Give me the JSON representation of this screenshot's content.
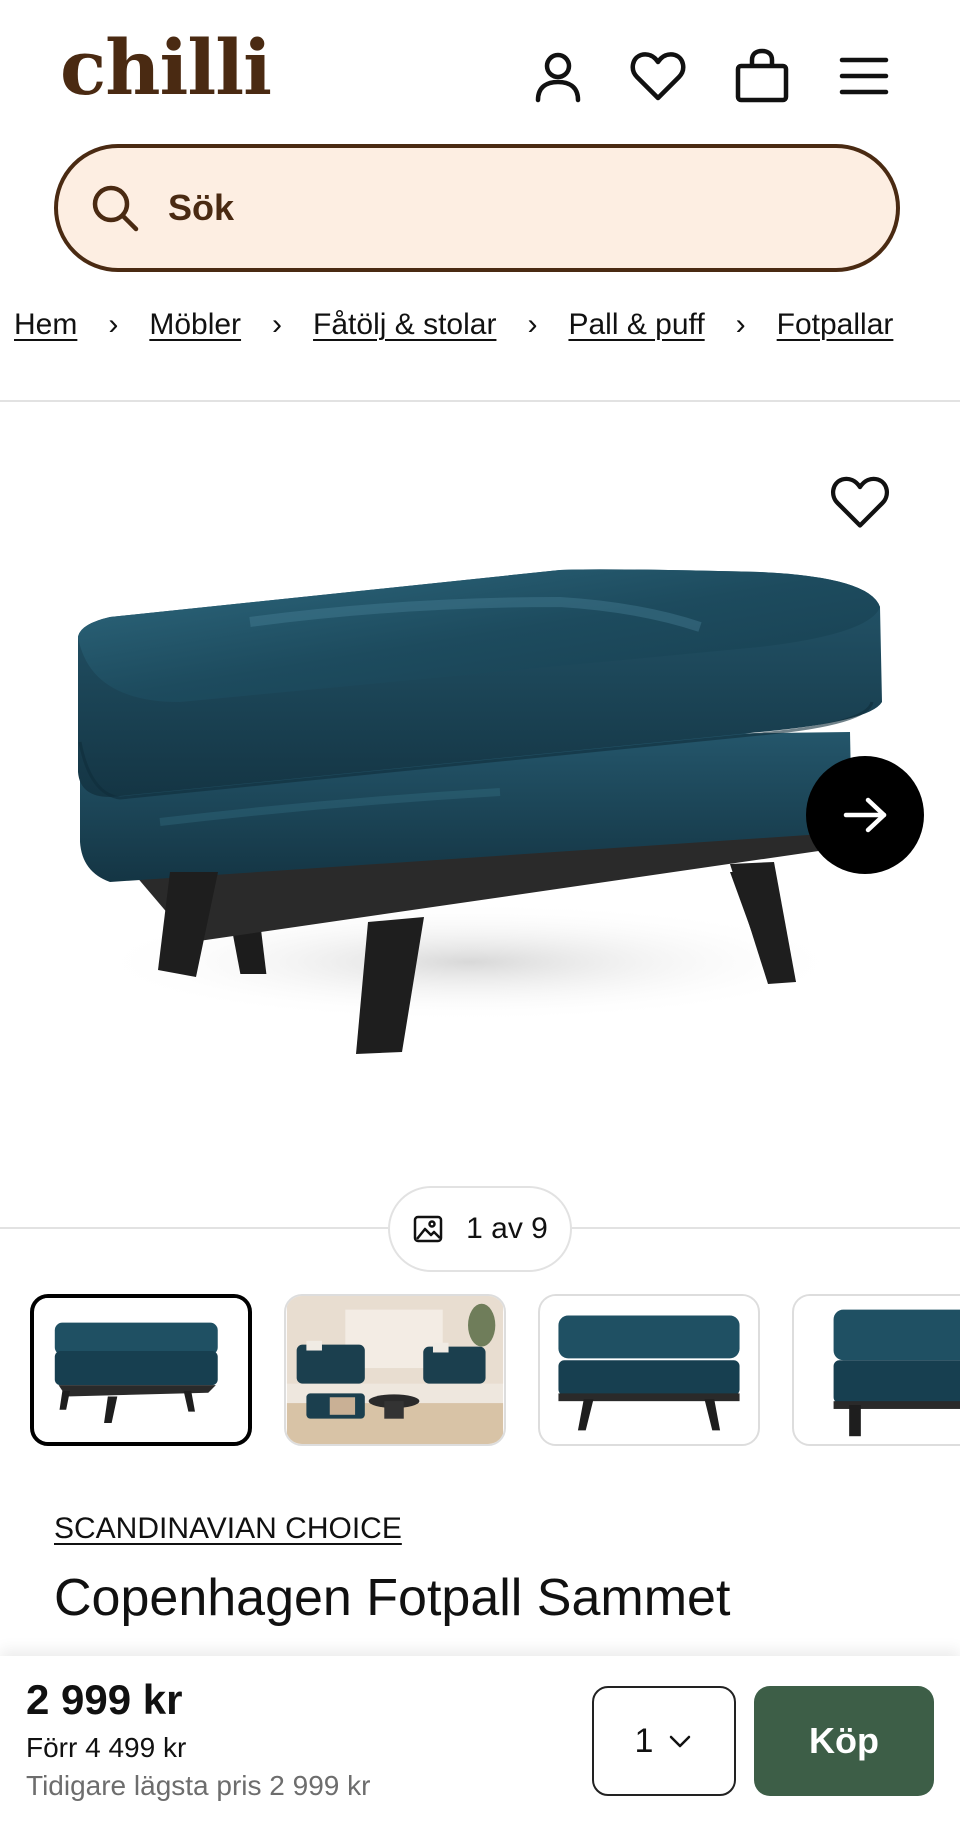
{
  "header": {
    "logo": "chilli",
    "icons": [
      "user-icon",
      "heart-icon",
      "shopping-bag-icon",
      "menu-icon"
    ]
  },
  "search": {
    "placeholder": "Sök"
  },
  "breadcrumb": {
    "items": [
      "Hem",
      "Möbler",
      "Fåtölj & stolar",
      "Pall & puff",
      "Fotpallar"
    ],
    "separator": "›"
  },
  "gallery": {
    "counter": "1 av 9",
    "thumbnail_count": 4
  },
  "product": {
    "brand": "SCANDINAVIAN CHOICE",
    "title": "Copenhagen Fotpall Sammet",
    "color": "#1d4b5e"
  },
  "buybar": {
    "price": "2 999 kr",
    "price_before": "Förr 4 499 kr",
    "price_lowest": "Tidigare lägsta pris 2 999 kr",
    "quantity": "1",
    "buy_label": "Köp"
  },
  "colors": {
    "brand_brown": "#4a2a12",
    "search_bg": "#fdeee2",
    "buy_green": "#3d5e47"
  }
}
